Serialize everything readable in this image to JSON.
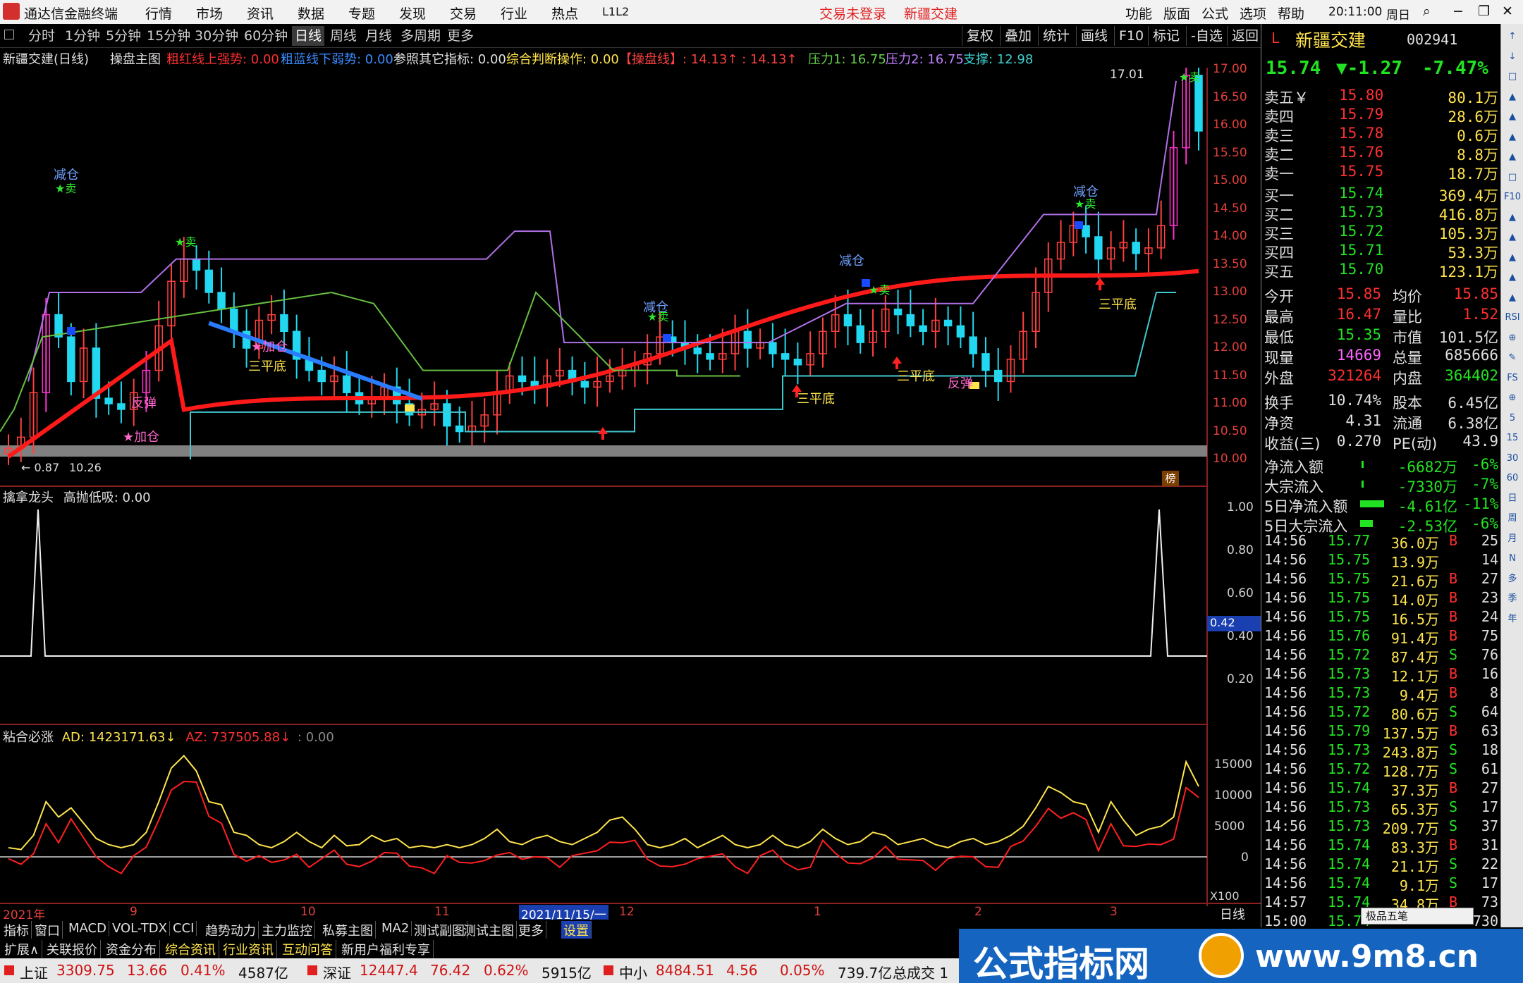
{
  "window": {
    "app_title": "通达信金融终端",
    "menus": [
      "行情",
      "市场",
      "资讯",
      "数据",
      "专题",
      "发现",
      "交易",
      "行业",
      "热点",
      "L1L2"
    ],
    "trade_status": "交易未登录",
    "stock_title": "新疆交建",
    "right_menus": [
      "功能",
      "版面",
      "公式",
      "选项",
      "帮助"
    ],
    "time": "20:11:00",
    "weekday": "周日"
  },
  "period_tabs": [
    "分时",
    "1分钟",
    "5分钟",
    "15分钟",
    "30分钟",
    "60分钟",
    "日线",
    "周线",
    "月线",
    "多周期",
    "更多"
  ],
  "active_tab": "日线",
  "toolbar_right": [
    "复权",
    "叠加",
    "统计",
    "画线",
    "F10",
    "标记",
    "-自选",
    "返回"
  ],
  "info_line": {
    "stock": "新疆交建(日线)",
    "main_name": "操盘主图",
    "red_line": "粗红线上强势: 0.00",
    "blue_line": "粗蓝线下弱势: 0.00",
    "ref": "参照其它指标: 0.00",
    "judge": "综合判断操作: 0.00",
    "op_line": "【操盘线】: 14.13↑ : 14.13↑",
    "p1": "压力1: 16.75",
    "p2": "压力2: 16.75",
    "sup": "支撑: 12.98"
  },
  "price_axis": [
    "17.00",
    "16.50",
    "16.00",
    "15.50",
    "15.00",
    "14.50",
    "14.00",
    "13.50",
    "13.00",
    "12.50",
    "12.00",
    "11.50",
    "11.00",
    "10.50",
    "10.00"
  ],
  "chart_labels": {
    "high_mark": "17.01",
    "low_mark": "10.26",
    "low_prefix": "← 0.87",
    "rank_btn": "榜"
  },
  "signals": [
    {
      "t": "减仓",
      "c": "#6fa0ff"
    },
    {
      "t": "★卖",
      "c": "#2ee82e"
    },
    {
      "t": "★加仓",
      "c": "#ff66cc"
    },
    {
      "t": "反弹",
      "c": "#ff66cc"
    },
    {
      "t": "三平底",
      "c": "#ffe44d"
    },
    {
      "t": "★卖",
      "c": "#2ee82e"
    }
  ],
  "sub1": {
    "name": "擒拿龙头",
    "indicator": "高抛低吸: 0.00",
    "axis": [
      "1.00",
      "0.80",
      "0.60",
      "0.40",
      "0.20"
    ],
    "cursor_value": "0.42"
  },
  "sub2": {
    "name": "粘合必涨",
    "ad": "AD: 1423171.63↓",
    "az": "AZ: 737505.88↓",
    "extra": ": 0.00",
    "axis": [
      "15000",
      "10000",
      "5000",
      "0"
    ],
    "scale": "X100"
  },
  "date_axis": [
    "2021年",
    "9",
    "10",
    "11",
    "2021/11/15/一",
    "12",
    "1",
    "2",
    "3"
  ],
  "period_label": "日线",
  "quote": {
    "name": "新疆交建",
    "code": "002941",
    "price": "15.74",
    "change": "▼-1.27",
    "pct": "-7.47%",
    "asks": [
      {
        "l": "卖五￥",
        "p": "15.80",
        "v": "80.1万"
      },
      {
        "l": "卖四",
        "p": "15.79",
        "v": "28.6万"
      },
      {
        "l": "卖三",
        "p": "15.78",
        "v": "0.6万"
      },
      {
        "l": "卖二",
        "p": "15.76",
        "v": "8.8万"
      },
      {
        "l": "卖一",
        "p": "15.75",
        "v": "18.7万"
      }
    ],
    "bids": [
      {
        "l": "买一",
        "p": "15.74",
        "v": "369.4万"
      },
      {
        "l": "买二",
        "p": "15.73",
        "v": "416.8万"
      },
      {
        "l": "买三",
        "p": "15.72",
        "v": "105.3万"
      },
      {
        "l": "买四",
        "p": "15.71",
        "v": "53.3万"
      },
      {
        "l": "买五",
        "p": "15.70",
        "v": "123.1万"
      }
    ],
    "stats": [
      [
        "今开",
        "15.85",
        "均价",
        "15.85"
      ],
      [
        "最高",
        "16.47",
        "量比",
        "1.52"
      ],
      [
        "最低",
        "15.35",
        "市值",
        "101.5亿"
      ],
      [
        "现量",
        "14669",
        "总量",
        "685666"
      ],
      [
        "外盘",
        "321264",
        "内盘",
        "364402"
      ]
    ],
    "stats2": [
      [
        "换手",
        "10.74%",
        "股本",
        "6.45亿"
      ],
      [
        "净资",
        "4.31",
        "流通",
        "6.38亿"
      ],
      [
        "收益(三)",
        "0.270",
        "PE(动)",
        "43.9"
      ]
    ],
    "flows": [
      [
        "净流入额",
        "-6682万",
        "-6%"
      ],
      [
        "大宗流入",
        "-7330万",
        "-7%"
      ],
      [
        "5日净流入额",
        "-4.61亿",
        "-11%"
      ],
      [
        "5日大宗流入",
        "-2.53亿",
        "-6%"
      ]
    ]
  },
  "ticks": [
    [
      "14:56",
      "15.77",
      "36.0万",
      "B",
      "25"
    ],
    [
      "14:56",
      "15.75",
      "13.9万",
      "",
      "14"
    ],
    [
      "14:56",
      "15.75",
      "21.6万",
      "B",
      "27"
    ],
    [
      "14:56",
      "15.75",
      "14.0万",
      "B",
      "23"
    ],
    [
      "14:56",
      "15.75",
      "16.5万",
      "B",
      "24"
    ],
    [
      "14:56",
      "15.76",
      "91.4万",
      "B",
      "75"
    ],
    [
      "14:56",
      "15.72",
      "87.4万",
      "S",
      "76"
    ],
    [
      "14:56",
      "15.73",
      "12.1万",
      "B",
      "16"
    ],
    [
      "14:56",
      "15.73",
      "9.4万",
      "B",
      "8"
    ],
    [
      "14:56",
      "15.72",
      "80.6万",
      "S",
      "64"
    ],
    [
      "14:56",
      "15.79",
      "137.5万",
      "B",
      "63"
    ],
    [
      "14:56",
      "15.73",
      "243.8万",
      "S",
      "18"
    ],
    [
      "14:56",
      "15.72",
      "128.7万",
      "S",
      "61"
    ],
    [
      "14:56",
      "15.74",
      "37.3万",
      "B",
      "27"
    ],
    [
      "14:56",
      "15.73",
      "65.3万",
      "S",
      "17"
    ],
    [
      "14:56",
      "15.73",
      "209.7万",
      "S",
      "37"
    ],
    [
      "14:56",
      "15.74",
      "83.3万",
      "B",
      "31"
    ],
    [
      "14:56",
      "15.74",
      "21.1万",
      "S",
      "22"
    ],
    [
      "14:56",
      "15.74",
      "9.1万",
      "S",
      "17"
    ],
    [
      "14:57",
      "15.74",
      "34.8万",
      "B",
      "73"
    ],
    [
      "15:00",
      "15.74",
      "",
      "",
      "730"
    ]
  ],
  "bottom_tabs": [
    "指标",
    "窗口",
    "MACD",
    "VOL-TDX",
    "CCI",
    "趋势动力",
    "主力监控",
    "私募主图",
    "MA2",
    "测试副图",
    "测试主图",
    "更多",
    "设置"
  ],
  "bottom2": [
    "扩展∧",
    "关联报价",
    "资金分布",
    "综合资讯",
    "行业资讯",
    "互动问答",
    "新用户福利专享"
  ],
  "status": [
    {
      "n": "上证",
      "v": "3309.75",
      "c": "13.66",
      "p": "0.41%",
      "a": "4587亿"
    },
    {
      "n": "深证",
      "v": "12447.4",
      "c": "76.42",
      "p": "0.62%",
      "a": "5915亿"
    },
    {
      "n": "中小",
      "v": "8484.51",
      "c": "4.56",
      "p": "0.05%",
      "a": "739.7亿"
    }
  ],
  "status_tail": "总成交 1",
  "banner": {
    "text": "公式指标网",
    "url": "www.9m8.cn",
    "popup": "极品五笔"
  },
  "side_tools": [
    "↑",
    "↓",
    "□",
    "▲",
    "▲",
    "▲",
    "▲",
    "□",
    "F10",
    "▲",
    "▲",
    "▲",
    "▲",
    "▲",
    "RSI",
    "⊕",
    "✎",
    "FS",
    "⊕",
    "5",
    "15",
    "30",
    "60",
    "日",
    "周",
    "月",
    "N",
    "多",
    "季",
    "年"
  ]
}
